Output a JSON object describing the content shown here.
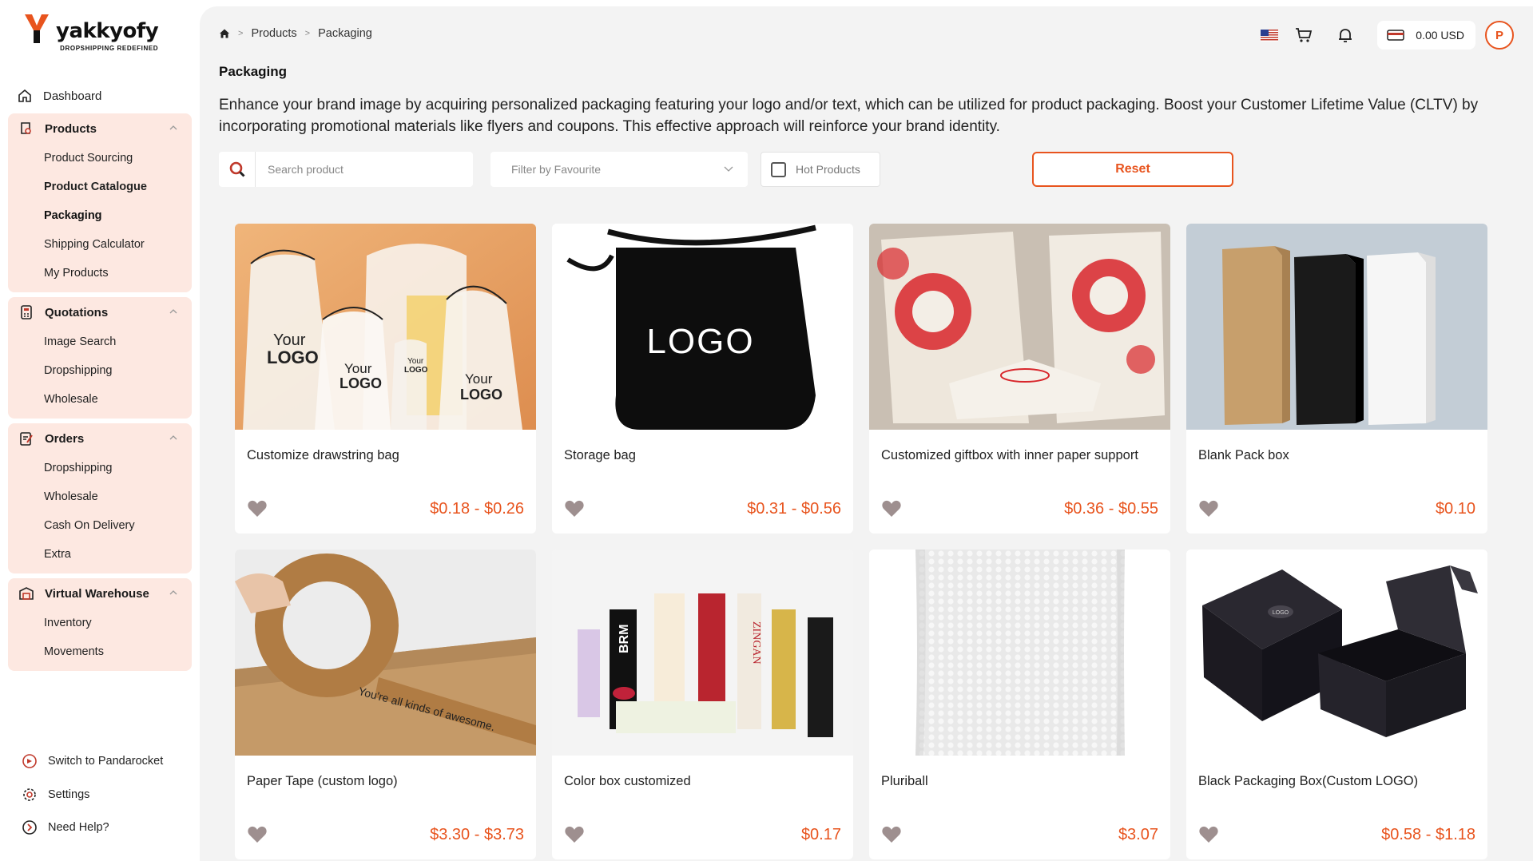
{
  "brand": {
    "name": "yakkyofy",
    "tagline": "DROPSHIPPING REDEFINED",
    "accent": "#e8541e"
  },
  "sidebar": {
    "dashboard": "Dashboard",
    "groups": [
      {
        "label": "Products",
        "items": [
          "Product Sourcing",
          "Product Catalogue",
          "Packaging",
          "Shipping Calculator",
          "My Products"
        ]
      },
      {
        "label": "Quotations",
        "items": [
          "Image Search",
          "Dropshipping",
          "Wholesale"
        ]
      },
      {
        "label": "Orders",
        "items": [
          "Dropshipping",
          "Wholesale",
          "Cash On Delivery",
          "Extra"
        ]
      },
      {
        "label": "Virtual Warehouse",
        "items": [
          "Inventory",
          "Movements"
        ]
      }
    ],
    "bottom": [
      "Switch to Pandarocket",
      "Settings",
      "Need Help?"
    ]
  },
  "breadcrumb": [
    "Products",
    "Packaging"
  ],
  "header": {
    "balance": "0.00 USD",
    "avatar_initial": "P"
  },
  "page": {
    "title": "Packaging",
    "description": "Enhance your brand image by acquiring personalized packaging featuring your logo and/or text, which can be utilized for product packaging. Boost your Customer Lifetime Value (CLTV) by incorporating promotional materials like flyers and coupons. This effective approach will reinforce your brand identity."
  },
  "filters": {
    "search_placeholder": "Search product",
    "favourite_filter": "Filter by Favourite",
    "hot_products": "Hot Products",
    "reset": "Reset"
  },
  "products": [
    {
      "name": "Customize drawstring bag",
      "price": "$0.18 - $0.26"
    },
    {
      "name": "Storage bag",
      "price": "$0.31 - $0.56"
    },
    {
      "name": "Customized giftbox with inner paper support",
      "price": "$0.36 - $0.55"
    },
    {
      "name": "Blank Pack box",
      "price": "$0.10"
    },
    {
      "name": "Paper Tape (custom logo)",
      "price": "$3.30 - $3.73"
    },
    {
      "name": "Color box customized",
      "price": "$0.17"
    },
    {
      "name": "Pluriball",
      "price": "$3.07"
    },
    {
      "name": "Black Packaging Box(Custom LOGO)",
      "price": "$0.58 - $1.18"
    }
  ],
  "product_image_text": {
    "drawstring": [
      "Your",
      "LOGO",
      "Your",
      "LOGO",
      "Your",
      "LOGO",
      "Your",
      "LOGO"
    ],
    "storage": "LOGO",
    "tape": "You're all kinds of awesome.",
    "colorbox": [
      "BRM",
      "ZINGAN"
    ],
    "blackbox": "LOGO"
  }
}
